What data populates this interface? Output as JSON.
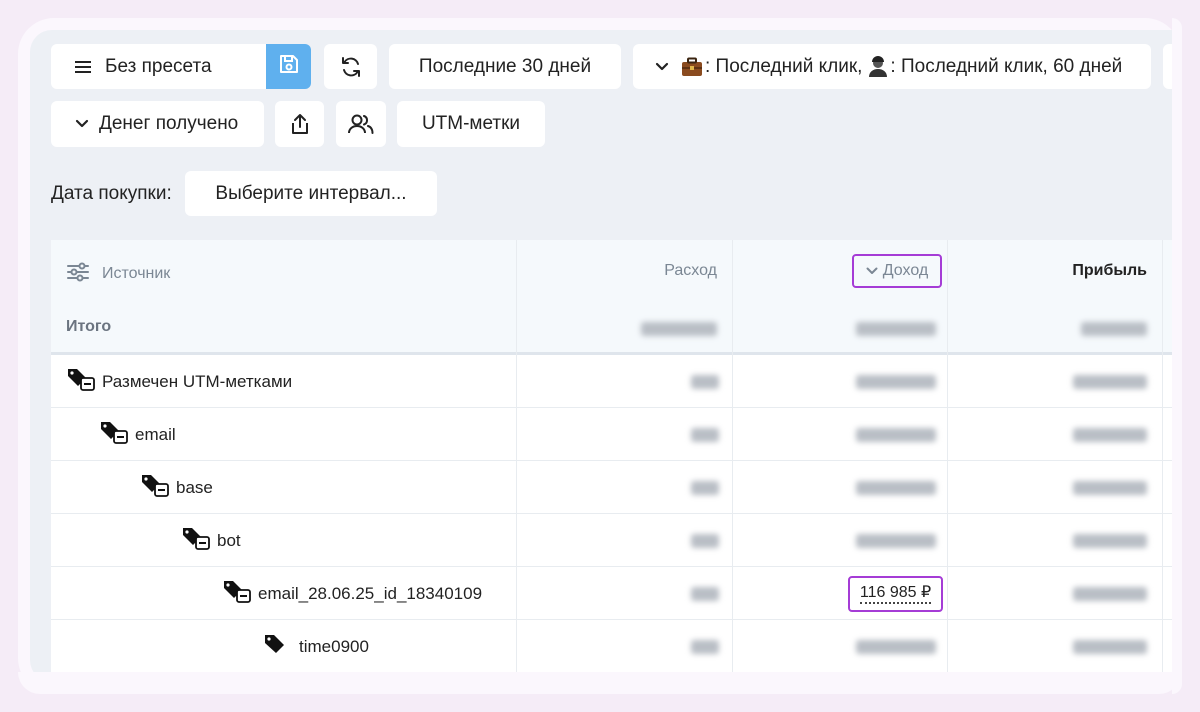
{
  "toolbar": {
    "preset_label": "Без пресета",
    "period_label": "Последние 30 дней",
    "attribution_label": ": Последний клик,  : Последний клик, 60 дней",
    "attribution_part1": ": Последний клик, ",
    "attribution_part2": ": Последний клик, 60 дней",
    "money_label": "Денег получено",
    "utm_label": "UTM-метки"
  },
  "filter": {
    "label": "Дата покупки:",
    "interval_placeholder": "Выберите интервал..."
  },
  "table": {
    "columns": {
      "source": "Источник",
      "expense": "Расход",
      "income": "Доход",
      "profit": "Прибыль"
    },
    "totals": {
      "label": "Итого"
    },
    "rows": [
      {
        "name": "Размечен UTM-метками",
        "level": 0,
        "expandable": true
      },
      {
        "name": "email",
        "level": 1,
        "expandable": true
      },
      {
        "name": "base",
        "level": 2,
        "expandable": true
      },
      {
        "name": "bot",
        "level": 3,
        "expandable": true
      },
      {
        "name": "email_28.06.25_id_18340109",
        "level": 4,
        "expandable": true,
        "income": "116 985 ₽"
      },
      {
        "name": "time0900",
        "level": 5,
        "expandable": false
      }
    ]
  },
  "colors": {
    "accent": "#a53cd6",
    "save_button": "#5fb0ee",
    "background": "#edf0f5"
  }
}
